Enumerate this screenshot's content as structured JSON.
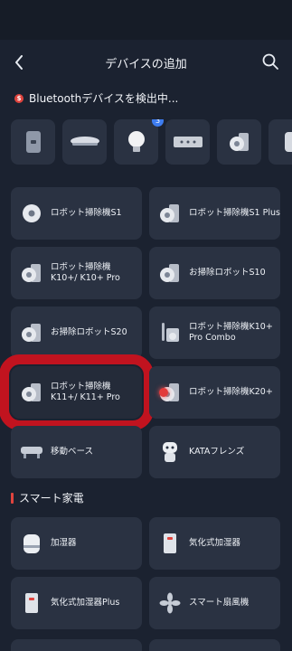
{
  "header": {
    "title": "デバイスの追加"
  },
  "scan": {
    "badge_symbol": "$",
    "text": "Bluetoothデバイスを検出中..."
  },
  "bluetooth_devices": [
    {
      "icon": "wall-unit-icon"
    },
    {
      "icon": "ceiling-light-icon"
    },
    {
      "icon": "light-bulb-icon",
      "badge": "3"
    },
    {
      "icon": "power-strip-icon"
    },
    {
      "icon": "robot-vacuum-icon"
    },
    {
      "icon": "cylinder-device-icon"
    }
  ],
  "devices": [
    {
      "label": "ロボット掃除機S1",
      "icon": "robot-vacuum-round-icon"
    },
    {
      "label": "ロボット掃除機S1 Plus",
      "icon": "robot-vacuum-dock-icon"
    },
    {
      "label": "ロボット掃除機K10+/ K10+ Pro",
      "icon": "robot-vacuum-dock-icon"
    },
    {
      "label": "お掃除ロボットS10",
      "icon": "robot-vacuum-dock-icon"
    },
    {
      "label": "お掃除ロボットS20",
      "icon": "robot-vacuum-dock-icon"
    },
    {
      "label": "ロボット掃除機K10+ Pro Combo",
      "icon": "stick-vacuum-icon"
    },
    {
      "label": "ロボット掃除機K11+/ K11+ Pro",
      "icon": "robot-vacuum-dock-icon",
      "highlighted": true
    },
    {
      "label": "ロボット掃除機K20+",
      "icon": "robot-vacuum-dock-icon"
    },
    {
      "label": "移動ベース",
      "icon": "mobile-base-icon"
    },
    {
      "label": "KATAフレンズ",
      "icon": "kata-friends-robot-icon"
    }
  ],
  "smart_home": {
    "section_title": "スマート家電",
    "items": [
      {
        "label": "加湿器",
        "icon": "humidifier-icon"
      },
      {
        "label": "気化式加湿器",
        "icon": "evaporative-humidifier-icon"
      },
      {
        "label": "気化式加湿器Plus",
        "icon": "evaporative-humidifier-plus-icon"
      },
      {
        "label": "スマート扇風機",
        "icon": "smart-fan-icon"
      }
    ]
  },
  "colors": {
    "background": "#1b2230",
    "card": "#2a3242",
    "highlight_ring": "#c1131f",
    "accent_red": "#e0443e",
    "badge_blue": "#3d7cf0"
  }
}
